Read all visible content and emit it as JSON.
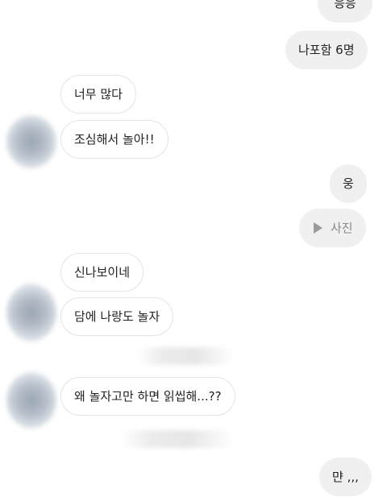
{
  "messages": {
    "m0": "응응",
    "m1": "나포함 6명",
    "m2": "너무 많다",
    "m3": "조심해서 놀아!!",
    "m4": "웅",
    "m5_label": "사진",
    "m6": "신나보이네",
    "m7": "담에 나랑도 놀자",
    "m8": "왜 놀자고만 하면 읽씹해...??",
    "m9": "먄 ,,,"
  },
  "icons": {
    "photo_play": "play-icon",
    "avatar": "blurred-avatar"
  },
  "colors": {
    "my_bubble": "#f0f0f0",
    "their_bubble": "#ffffff",
    "their_border": "#e3e3e3",
    "text": "#222222",
    "photo_text": "#8a8a8a"
  }
}
